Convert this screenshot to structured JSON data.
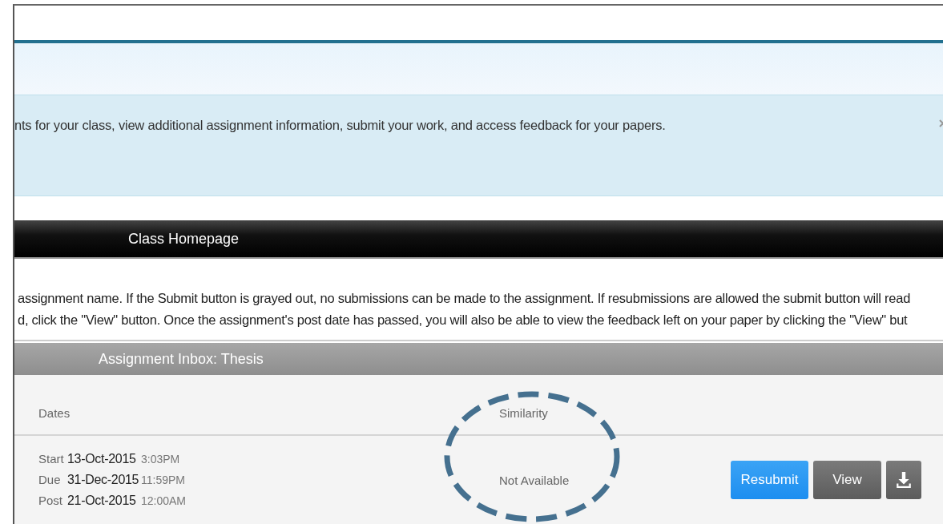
{
  "info_banner": {
    "text": "nts for your class, view additional assignment information, submit your work, and access feedback for your papers."
  },
  "class_bar": {
    "title": "Class Homepage"
  },
  "instructions": [
    "assignment name. If the Submit button is grayed out, no submissions can be made to the assignment. If resubmissions are allowed the submit button will read",
    "d, click the \"View\" button. Once the assignment's post date has passed, you will also be able to view the feedback left on your paper by clicking the \"View\" but"
  ],
  "inbox": {
    "title": "Assignment Inbox: Thesis",
    "columns": [
      "Dates",
      "Similarity"
    ],
    "rows": [
      {
        "dates": [
          {
            "label": "Start",
            "date": "13-Oct-2015",
            "time": "3:03PM"
          },
          {
            "label": "Due",
            "date": "31-Dec-2015",
            "time": "11:59PM"
          },
          {
            "label": "Post",
            "date": "21-Oct-2015",
            "time": "12:00AM"
          }
        ],
        "similarity": "Not Available",
        "actions": [
          {
            "kind": "primary",
            "label": "Resubmit"
          },
          {
            "kind": "secondary",
            "label": "View"
          },
          {
            "kind": "download"
          }
        ]
      }
    ]
  },
  "annotations": [
    {
      "kind": "dashed-ellipse"
    }
  ]
}
